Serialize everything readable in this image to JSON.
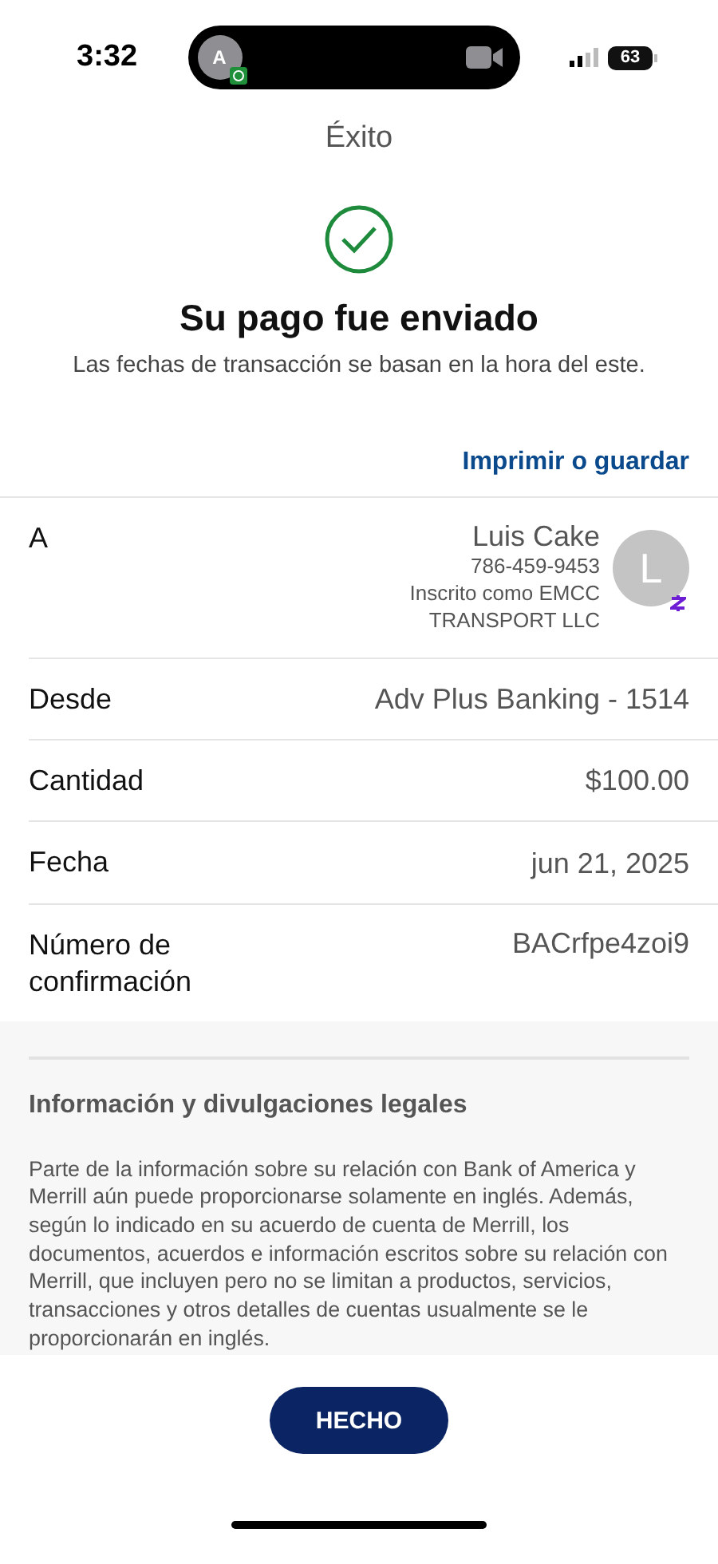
{
  "status_bar": {
    "time": "3:32",
    "caller_initial": "A",
    "battery": "63"
  },
  "title": "Éxito",
  "heading": "Su pago fue enviado",
  "subtitle": "Las fechas de transacción se basan en la hora del este.",
  "print_link": "Imprimir o guardar",
  "recipient": {
    "label": "A",
    "name": "Luis Cake",
    "phone": "786-459-9453",
    "enrolled": "Inscrito como EMCC TRANSPORT LLC",
    "avatar_initial": "L"
  },
  "details": [
    {
      "label": "Desde",
      "value": "Adv Plus Banking - 1514"
    },
    {
      "label": "Cantidad",
      "value": "$100.00"
    },
    {
      "label": "Fecha",
      "value": "jun 21, 2025"
    },
    {
      "label": "Número de confirmación",
      "value": "BACrfpe4zoi9"
    }
  ],
  "legal": {
    "title": "Información y divulgaciones legales",
    "text": "Parte de la información sobre su relación con Bank of America y Merrill aún puede proporcionarse solamente en inglés. Además, según lo indicado en su acuerdo de cuenta de Merrill, los documentos, acuerdos e información escritos sobre su relación con Merrill, que incluyen pero no se limitan a productos, servicios, transacciones y otros detalles de cuentas usualmente se le proporcionarán en inglés."
  },
  "done_button": "HECHO"
}
